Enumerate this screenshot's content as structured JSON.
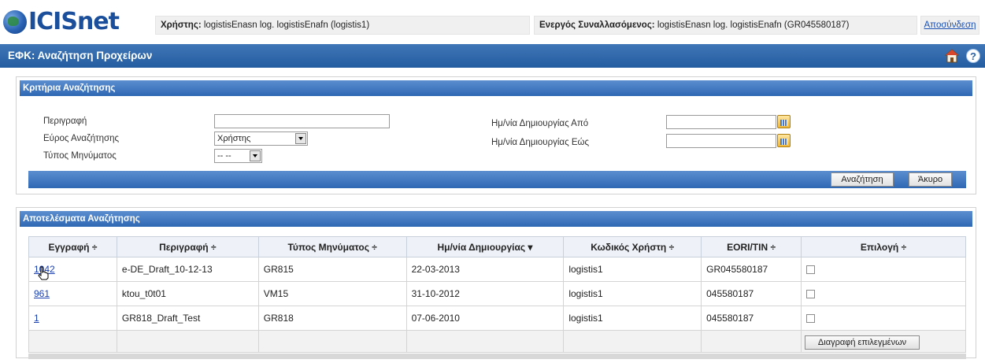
{
  "header": {
    "logo_text": "ICISnet",
    "user_label": "Χρήστης:",
    "user_value": "logistisEnasn log. logistisEnafn (logistis1)",
    "trader_label": "Ενεργός Συναλλασόμενος:",
    "trader_value": "logistisEnasn log. logistisEnafn (GR045580187)",
    "logout_label": "Αποσύνδεση"
  },
  "titlebar": {
    "title": "ΕΦΚ: Αναζήτηση Προχείρων",
    "help_glyph": "?"
  },
  "criteria": {
    "heading": "Κριτήρια Αναζήτησης",
    "description_label": "Περιγραφή",
    "description_value": "",
    "scope_label": "Εύρος Αναζήτησης",
    "scope_value": "Χρήστης",
    "msgtype_label": "Τύπος Μηνύματος",
    "msgtype_value": "-- --",
    "date_from_label": "Ημ/νία Δημιουργίας Από",
    "date_from_value": "",
    "date_to_label": "Ημ/νία Δημιουργίας Εώς",
    "date_to_value": "",
    "search_button": "Αναζήτηση",
    "cancel_button": "Άκυρο"
  },
  "results": {
    "heading": "Αποτελέσματα Αναζήτησης",
    "columns": [
      "Εγγραφή ÷",
      "Περιγραφή ÷",
      "Τύπος Μηνύματος ÷",
      "Ημ/νία Δημιουργίας ▾",
      "Κωδικός Χρήστη ÷",
      "EORI/TIN ÷",
      "Επιλογή ÷"
    ],
    "rows": [
      {
        "id": "1042",
        "description": "e-DE_Draft_10-12-13",
        "msg_type": "GR815",
        "date": "22-03-2013",
        "user": "logistis1",
        "eori": "GR045580187"
      },
      {
        "id": "961",
        "description": "ktou_t0t01",
        "msg_type": "VM15",
        "date": "31-10-2012",
        "user": "logistis1",
        "eori": "045580187"
      },
      {
        "id": "1",
        "description": "GR818_Draft_Test",
        "msg_type": "GR818",
        "date": "07-06-2010",
        "user": "logistis1",
        "eori": "045580187"
      }
    ],
    "delete_button": "Διαγραφή επιλεγμένων"
  },
  "colors": {
    "header_blue": "#2f68b3",
    "link_blue": "#1a3fb0"
  },
  "icons": [
    "home-icon",
    "help-icon",
    "calendar-icon",
    "dropdown-arrow-icon",
    "hand-cursor-icon"
  ]
}
